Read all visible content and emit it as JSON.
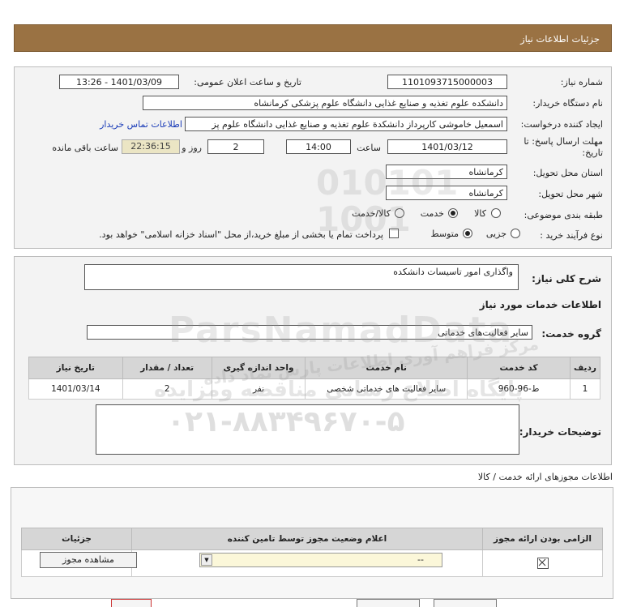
{
  "window": {
    "title": "جزئیات اطلاعات نیاز"
  },
  "form": {
    "need_number_label": "شماره نیاز:",
    "need_number": "1101093715000003",
    "announce_label": "تاریخ و ساعت اعلان عمومی:",
    "announce_value": "1401/03/09 - 13:26",
    "buyer_org_label": "نام دستگاه خریدار:",
    "buyer_org": "دانشکده علوم تغذیه و صنایع غذایی دانشگاه علوم پزشکی کرمانشاه",
    "requester_label": "ایجاد کننده درخواست:",
    "requester": "اسمعیل خاموشی کارپرداز دانشکدة علوم تغذیه و صنایع غذایی دانشگاه علوم پز",
    "contact_link": "اطلاعات تماس خریدار",
    "deadline_label_1": "مهلت ارسال پاسخ: تا",
    "deadline_label_2": "تاریخ:",
    "deadline_date": "1401/03/12",
    "hour_label": "ساعت",
    "deadline_time": "14:00",
    "days_value": "2",
    "days_label": "روز و",
    "remaining_time": "22:36:15",
    "remaining_label": "ساعت باقی مانده",
    "province_label": "استان محل تحویل:",
    "province": "کرمانشاه",
    "city_label": "شهر محل تحویل:",
    "city": "کرمانشاه",
    "category_label": "طبقه بندی موضوعی:",
    "category_options": [
      "کالا",
      "خدمت",
      "کالا/خدمت"
    ],
    "category_selected": "خدمت",
    "process_label": "نوع فرآیند خرید :",
    "process_options": [
      "جزیی",
      "متوسط"
    ],
    "process_selected": "متوسط",
    "payment_note": "پرداخت تمام یا بخشی از مبلغ خرید،از محل \"اسناد خزانه اسلامی\" خواهد بود."
  },
  "need": {
    "summary_label": "شرح کلی نیاز:",
    "summary": "واگذاری امور تاسیسات دانشکده",
    "services_header": "اطلاعات خدمات مورد نیاز",
    "service_group_label": "گروه خدمت:",
    "service_group": "سایر فعالیت‌های خدماتی",
    "table": {
      "headers": [
        "ردیف",
        "کد خدمت",
        "نام خدمت",
        "واحد اندازه گیری",
        "تعداد / مقدار",
        "تاریخ نیاز"
      ],
      "rows": [
        [
          "1",
          "ط-96-960",
          "سایر فعالیت های خدماتی شخصی",
          "نفر",
          "2",
          "1401/03/14"
        ]
      ]
    },
    "buyer_notes_label": "توضیحات خریدار:"
  },
  "permits": {
    "section_title": "اطلاعات مجوزهای ارائه خدمت / کالا",
    "headers": [
      "الزامی بودن ارائه مجوز",
      "اعلام وضعیت مجوز توسط تامین کننده",
      "جزئیات"
    ],
    "select_value": "--",
    "view_button": "مشاهده مجوز"
  },
  "watermark": {
    "brand": "ParsNamadData",
    "line1": "مرکز فراهم آوری اطلاعات پارس نماد داده",
    "line2": "پایگاه اطلاع رسانی مناقصه ومزایده",
    "phone": "۰۲۱-۸۸۳۴۹۶۷۰-۵"
  },
  "colors": {
    "titlebar": "#9a7243",
    "timer_bg": "#ebe5c4",
    "link": "#1a3cb8"
  }
}
